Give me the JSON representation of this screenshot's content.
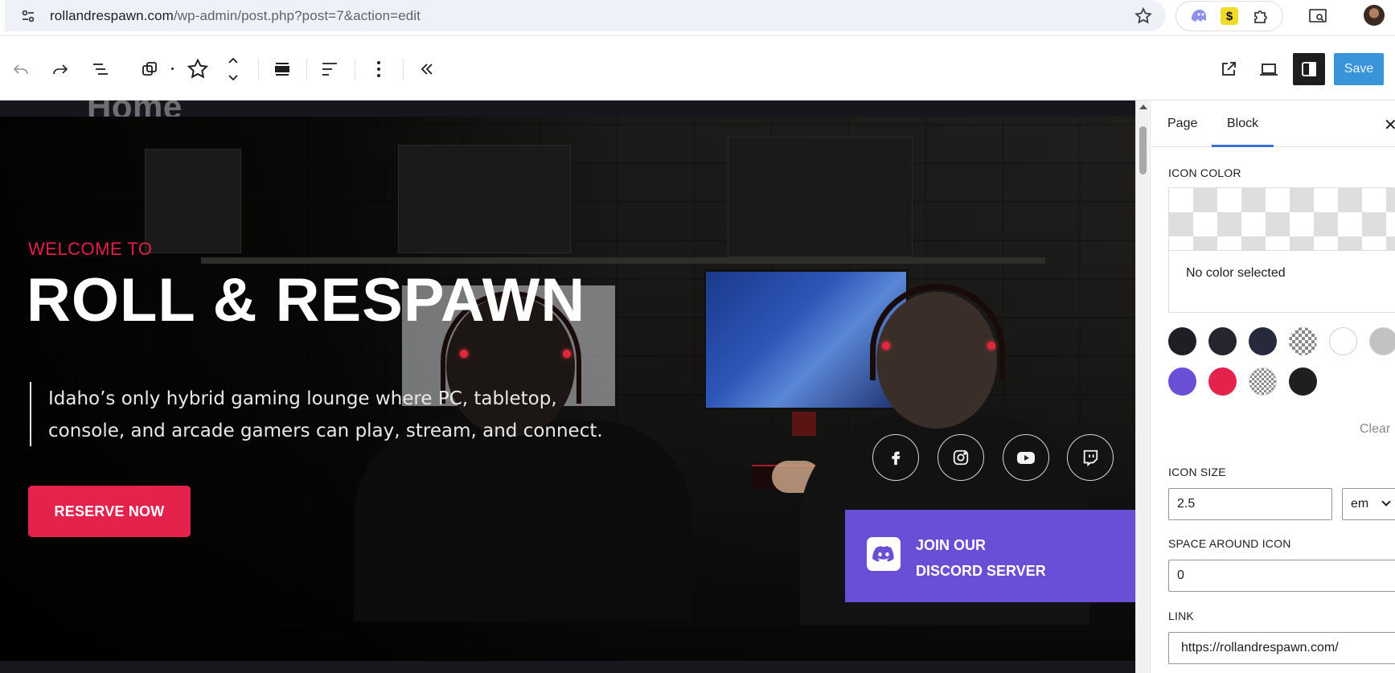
{
  "browser": {
    "url_host": "rollandrespawn.com",
    "url_path": "/wp-admin/post.php?post=7&action=edit",
    "extensions": [
      "ghost-extension-icon",
      "s-extension-icon",
      "puzzle-icon"
    ]
  },
  "toolbar": {
    "save_label": "Save",
    "icons": [
      "undo-icon",
      "redo-icon",
      "list-view-icon",
      "duplicate-icon",
      "star-icon",
      "move-up-down-icon",
      "align-full-icon",
      "justify-left-icon",
      "more-options-icon",
      "collapse-icon",
      "view-external-icon",
      "device-preview-icon",
      "sidebar-toggle-icon"
    ]
  },
  "canvas": {
    "page_title": "Home",
    "welcome": "WELCOME TO",
    "title": "ROLL & RESPAWN",
    "description": "Idaho’s only hybrid gaming lounge where PC, tabletop, console, and arcade gamers can play, stream, and connect.",
    "reserve_label": "RESERVE NOW",
    "social": [
      "facebook-icon",
      "instagram-icon",
      "youtube-icon",
      "twitch-icon"
    ],
    "discord_line1": "JOIN OUR",
    "discord_line2": "DISCORD SERVER"
  },
  "sidebar": {
    "tabs": [
      "Page",
      "Block"
    ],
    "active_tab": "Block",
    "icon_color_label": "ICON COLOR",
    "no_color_text": "No color selected",
    "swatches": [
      "#1e1e24",
      "#25252d",
      "#262a3a",
      "checkered",
      "#ffffff",
      "#c2c2c4",
      "#6a4fd6",
      "#e3234c",
      "checkered-fine",
      "#1f1f1f"
    ],
    "clear_label": "Clear",
    "icon_size_label": "ICON SIZE",
    "icon_size_value": "2.5",
    "icon_size_unit": "em",
    "space_label": "SPACE AROUND ICON",
    "space_value": "0",
    "link_label": "LINK",
    "link_value": "https://rollandrespawn.com/"
  },
  "colors": {
    "accent_red": "#e3234c",
    "discord_purple": "#6a4fd6",
    "save_blue": "#2f8fd8"
  }
}
